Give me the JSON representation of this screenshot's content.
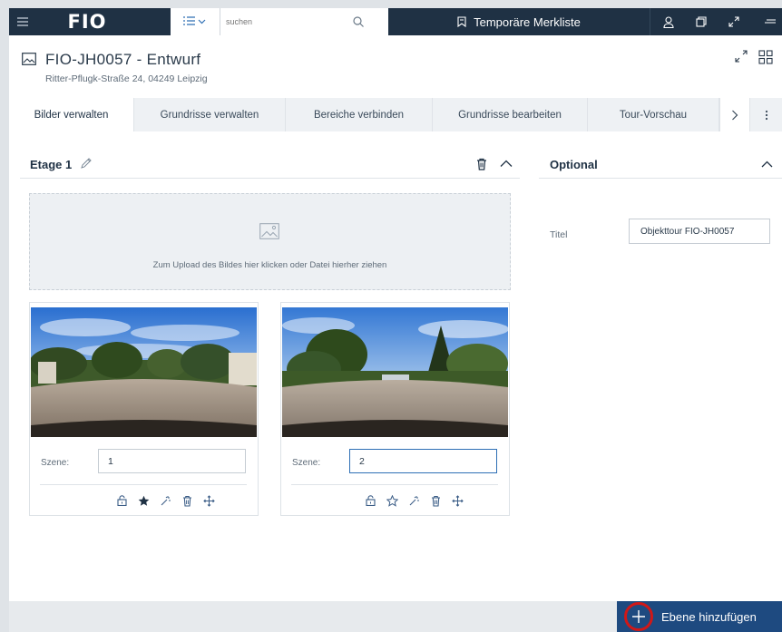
{
  "topbar": {
    "logo": "FIO",
    "search_placeholder": "suchen",
    "merkliste_label": "Temporäre Merkliste",
    "icons": [
      "menu-icon",
      "list-icon",
      "search-icon",
      "bookmark-icon",
      "user-icon",
      "window-icon",
      "expand-icon",
      "more-icon"
    ]
  },
  "header": {
    "title": "FIO-JH0057 - Entwurf",
    "address": "Ritter-Pflugk-Straße 24, 04249 Leipzig"
  },
  "tabs": [
    {
      "label": "Bilder verwalten",
      "active": true
    },
    {
      "label": "Grundrisse verwalten",
      "active": false
    },
    {
      "label": "Bereiche verbinden",
      "active": false
    },
    {
      "label": "Grundrisse bearbeiten",
      "active": false
    },
    {
      "label": "Tour-Vorschau",
      "active": false
    }
  ],
  "floor": {
    "title": "Etage 1",
    "upload_text": "Zum Upload des Bildes hier klicken oder Datei hierher ziehen"
  },
  "scenes": [
    {
      "label": "Szene:",
      "value": "1",
      "starred": true
    },
    {
      "label": "Szene:",
      "value": "2",
      "starred": false
    }
  ],
  "optional": {
    "title": "Optional",
    "field_label": "Titel",
    "field_value": "Objekttour FIO-JH0057"
  },
  "footer": {
    "add_label": "Ebene hinzufügen"
  },
  "colors": {
    "topbar": "#1f3144",
    "accent": "#1e4a80",
    "highlight_ring": "#d01818"
  }
}
